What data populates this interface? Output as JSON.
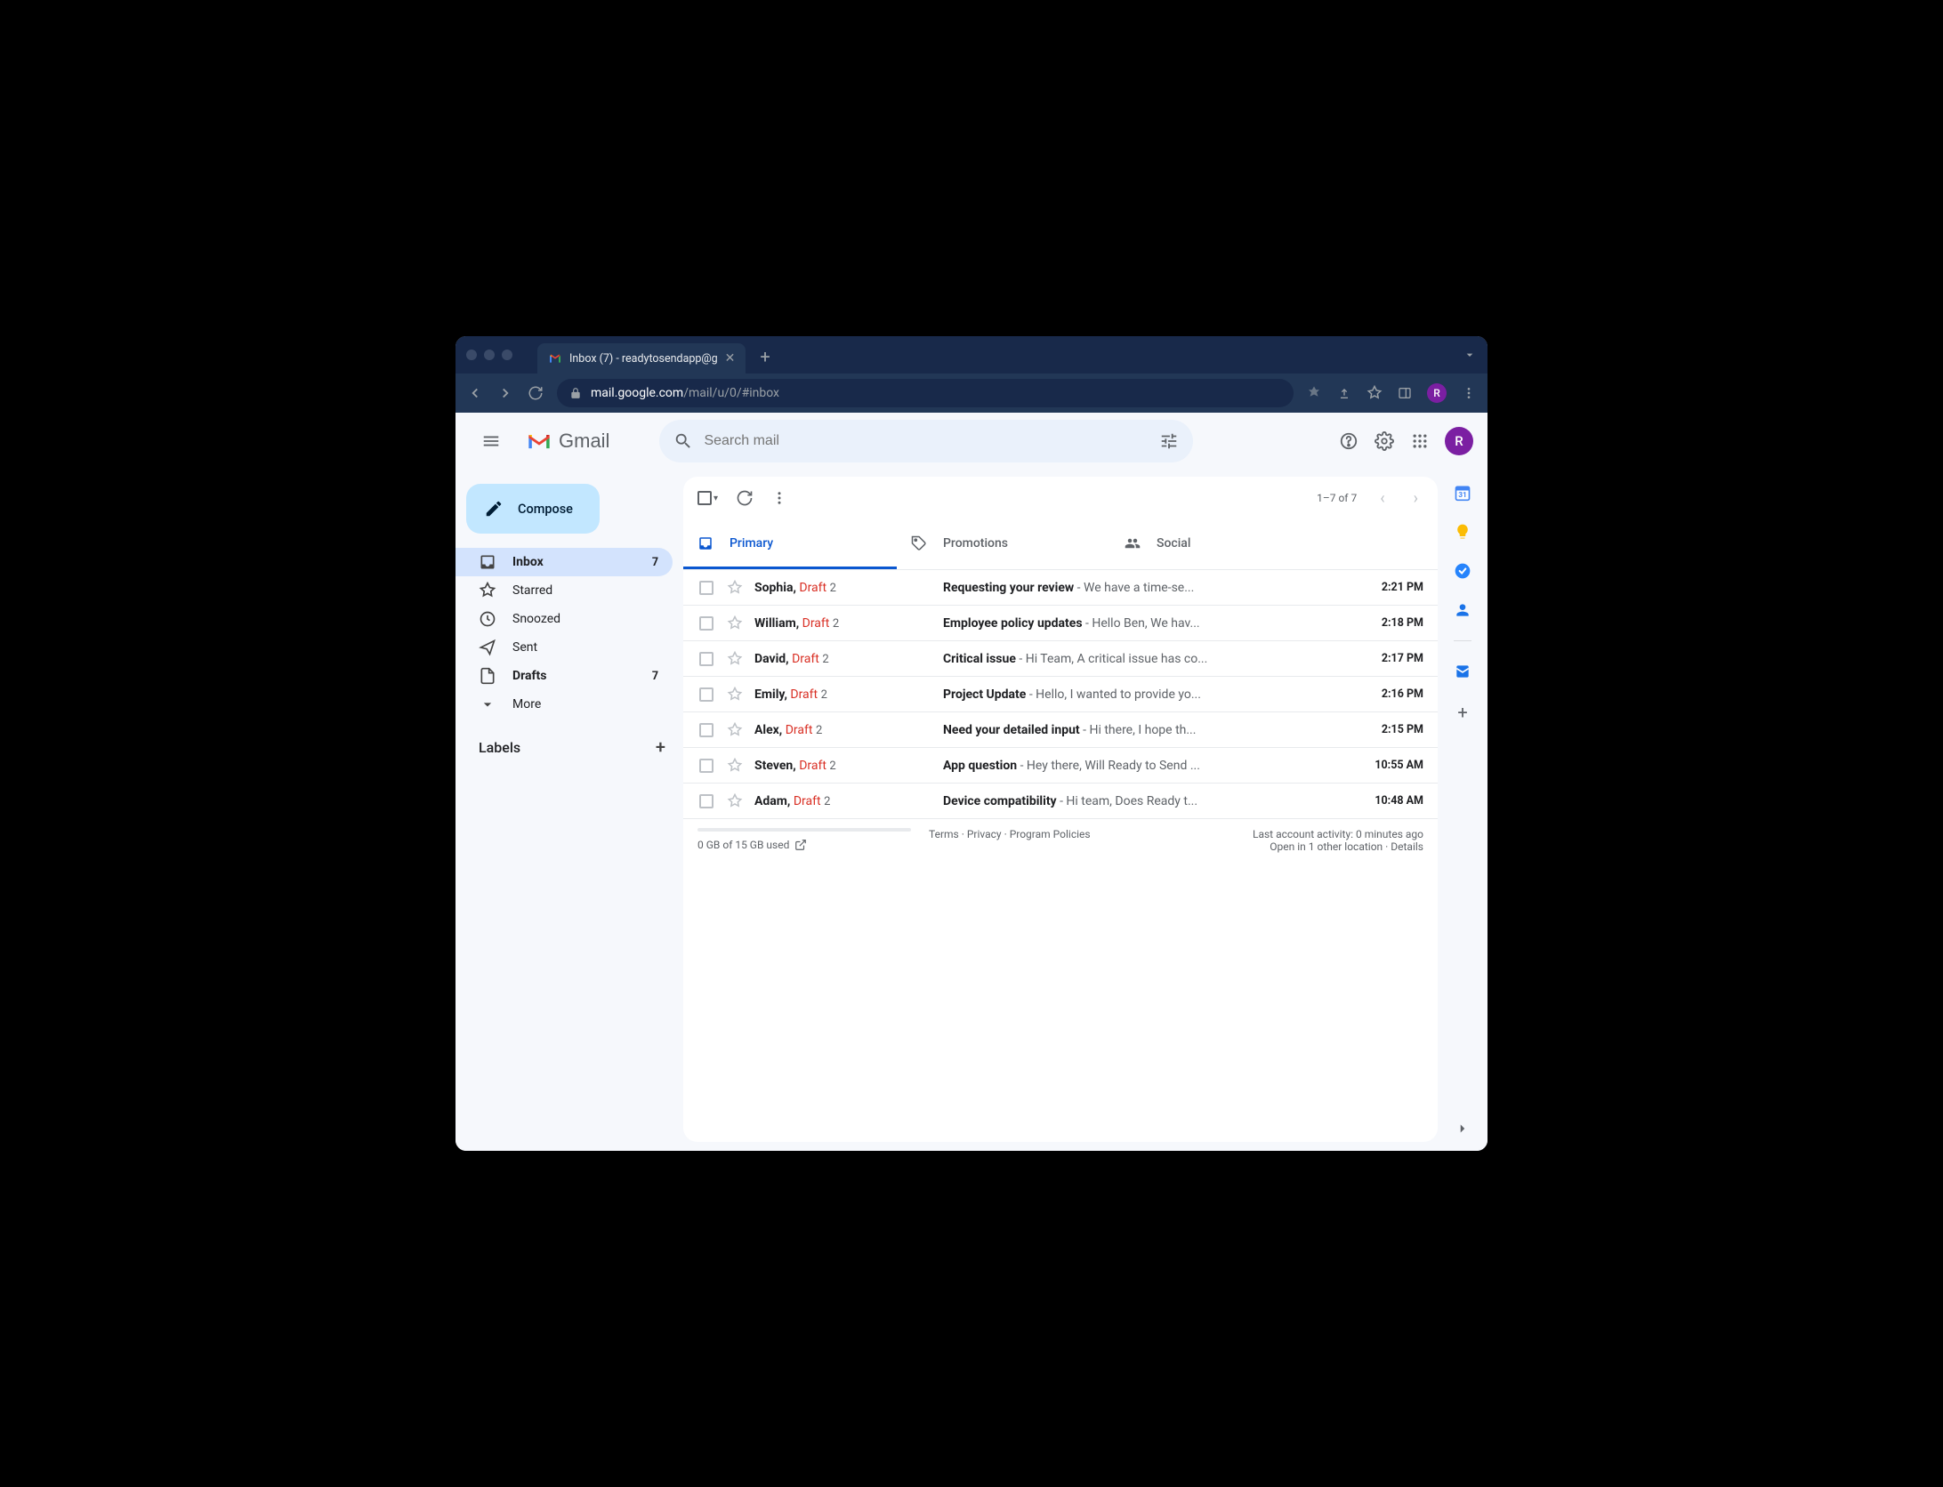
{
  "browser": {
    "tab_title": "Inbox (7) - readytosendapp@g",
    "url_host": "mail.google.com",
    "url_path": "/mail/u/0/#inbox",
    "profile_letter": "R"
  },
  "header": {
    "app_name": "Gmail",
    "search_placeholder": "Search mail",
    "account_letter": "R"
  },
  "sidebar": {
    "compose_label": "Compose",
    "items": [
      {
        "label": "Inbox",
        "count": "7"
      },
      {
        "label": "Starred",
        "count": ""
      },
      {
        "label": "Snoozed",
        "count": ""
      },
      {
        "label": "Sent",
        "count": ""
      },
      {
        "label": "Drafts",
        "count": "7"
      },
      {
        "label": "More",
        "count": ""
      }
    ],
    "labels_header": "Labels"
  },
  "toolbar": {
    "page_info": "1–7 of 7"
  },
  "tabs": {
    "primary": "Primary",
    "promotions": "Promotions",
    "social": "Social"
  },
  "emails": [
    {
      "sender": "Sophia",
      "draft": "Draft",
      "count": "2",
      "subject": "Requesting your review",
      "snippet": "We have a time-se...",
      "time": "2:21 PM"
    },
    {
      "sender": "William",
      "draft": "Draft",
      "count": "2",
      "subject": "Employee policy updates",
      "snippet": "Hello Ben, We hav...",
      "time": "2:18 PM"
    },
    {
      "sender": "David",
      "draft": "Draft",
      "count": "2",
      "subject": "Critical issue",
      "snippet": "Hi Team, A critical issue has co...",
      "time": "2:17 PM"
    },
    {
      "sender": "Emily",
      "draft": "Draft",
      "count": "2",
      "subject": "Project Update",
      "snippet": "Hello, I wanted to provide yo...",
      "time": "2:16 PM"
    },
    {
      "sender": "Alex",
      "draft": "Draft",
      "count": "2",
      "subject": "Need your detailed input",
      "snippet": "Hi there, I hope th...",
      "time": "2:15 PM"
    },
    {
      "sender": "Steven",
      "draft": "Draft",
      "count": "2",
      "subject": "App question",
      "snippet": "Hey there, Will Ready to Send ...",
      "time": "10:55 AM"
    },
    {
      "sender": "Adam",
      "draft": "Draft",
      "count": "2",
      "subject": "Device compatibility",
      "snippet": "Hi team, Does Ready t...",
      "time": "10:48 AM"
    }
  ],
  "footer": {
    "storage": "0 GB of 15 GB used",
    "terms": "Terms",
    "privacy": "Privacy",
    "policies": "Program Policies",
    "activity": "Last account activity: 0 minutes ago",
    "open_in": "Open in 1 other location",
    "details": "Details"
  },
  "sep": " · ",
  "snippet_sep": " - "
}
